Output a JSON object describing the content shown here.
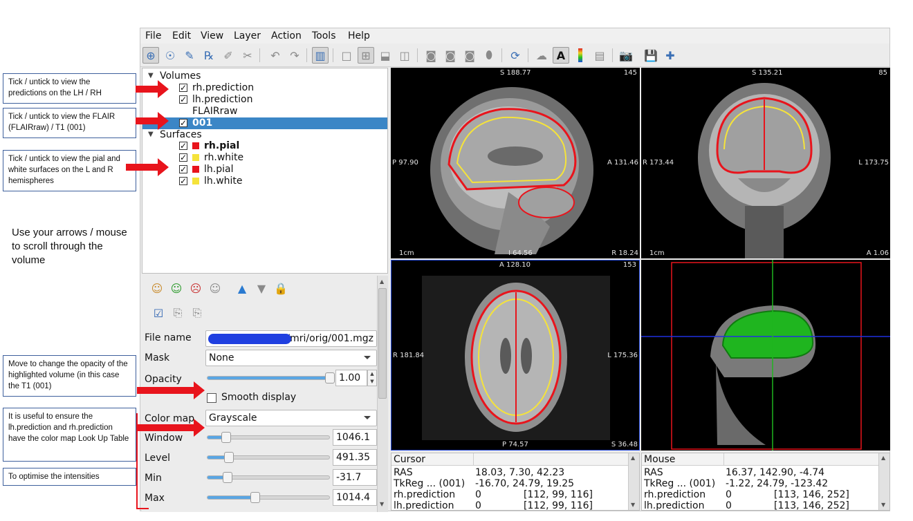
{
  "menu": [
    "File",
    "Edit",
    "View",
    "Layer",
    "Action",
    "Tools",
    "Help"
  ],
  "tree": {
    "volumes_label": "Volumes",
    "volumes": [
      {
        "label": "rh.prediction",
        "checked": true
      },
      {
        "label": "lh.prediction",
        "checked": true
      },
      {
        "label": "FLAIRraw",
        "checked": false
      },
      {
        "label": "001",
        "checked": true,
        "selected": true
      }
    ],
    "surfaces_label": "Surfaces",
    "surfaces": [
      {
        "label": "rh.pial",
        "checked": true,
        "color": "#e8141c"
      },
      {
        "label": "rh.white",
        "checked": true,
        "color": "#f5e33a"
      },
      {
        "label": "lh.pial",
        "checked": true,
        "color": "#e8141c"
      },
      {
        "label": "lh.white",
        "checked": true,
        "color": "#f5e33a"
      }
    ]
  },
  "props": {
    "file_name_label": "File name",
    "file_name_value": "/mri/orig/001.mgz",
    "mask_label": "Mask",
    "mask_value": "None",
    "opacity_label": "Opacity",
    "opacity_value": "1.00",
    "opacity_level": 1.0,
    "smooth_label": "Smooth display",
    "color_map_label": "Color map",
    "color_map_value": "Grayscale",
    "window_label": "Window",
    "window_value": "1046.1",
    "level_label": "Level",
    "level_value": "491.35",
    "min_label": "Min",
    "min_value": "-31.7",
    "max_label": "Max",
    "max_value": "1014.4"
  },
  "views": {
    "sagittal": {
      "top": "S 188.77",
      "corner": "145",
      "left": "P 97.90",
      "right": "A 131.46",
      "scale": "1cm",
      "bottom": "I 64.56",
      "bottom_right": "R 18.24"
    },
    "coronal": {
      "top": "S 135.21",
      "corner": "85",
      "left": "R 173.44",
      "right": "L 173.75",
      "scale": "1cm",
      "bottom_right": "A 1.06"
    },
    "axial": {
      "top": "A 128.10",
      "corner": "153",
      "left": "R 181.84",
      "right": "L 175.36",
      "bottom": "P 74.57",
      "bottom_right": "S 36.48"
    }
  },
  "info_cursor": {
    "header": "Cursor",
    "rows": [
      {
        "k": "RAS",
        "v": "18.03, 7.30, 42.23",
        "v2": ""
      },
      {
        "k": "TkReg ... (001)",
        "v": "-16.70, 24.79, 19.25",
        "v2": ""
      },
      {
        "k": "rh.prediction",
        "v": "0",
        "v2": "[112, 99, 116]"
      },
      {
        "k": "lh.prediction",
        "v": "0",
        "v2": "[112, 99, 116]"
      }
    ]
  },
  "info_mouse": {
    "header": "Mouse",
    "rows": [
      {
        "k": "RAS",
        "v": "16.37, 142.90, -4.74",
        "v2": ""
      },
      {
        "k": "TkReg ... (001)",
        "v": "-1.22, 24.79, -123.42",
        "v2": ""
      },
      {
        "k": "rh.prediction",
        "v": "0",
        "v2": "[113, 146, 252]"
      },
      {
        "k": "lh.prediction",
        "v": "0",
        "v2": "[113, 146, 252]"
      }
    ]
  },
  "notes": {
    "n1": "Tick / untick to view the predictions on the LH / RH",
    "n2": "Tick / untick to view the FLAIR (FLAIRraw) / T1 (001)",
    "n3": "Tick / untick to view the pial and white surfaces on the L and R hemispheres",
    "scroll": "Use your arrows / mouse to scroll through the volume",
    "n4": "Move to change the opacity of the highlighted volume (in this case the T1 (001)",
    "n5": "It is useful to ensure the lh.prediction and rh.prediction have the color map Look Up Table",
    "n6": "To optimise the intensities"
  },
  "colors": {
    "accent": "#3b86c6",
    "arrow": "#e8141c",
    "note_border": "#3d5f9c",
    "surface_green": "#1fb51f"
  }
}
